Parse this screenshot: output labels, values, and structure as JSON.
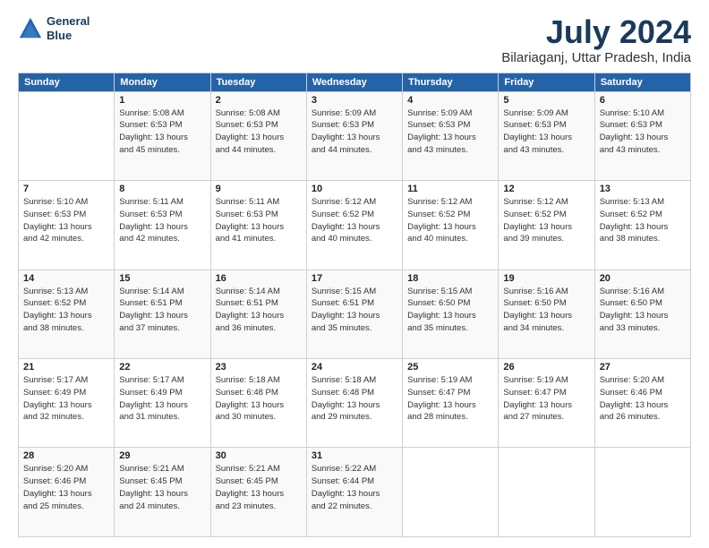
{
  "logo": {
    "line1": "General",
    "line2": "Blue"
  },
  "title": "July 2024",
  "subtitle": "Bilariaganj, Uttar Pradesh, India",
  "header_days": [
    "Sunday",
    "Monday",
    "Tuesday",
    "Wednesday",
    "Thursday",
    "Friday",
    "Saturday"
  ],
  "weeks": [
    [
      {
        "day": "",
        "info": ""
      },
      {
        "day": "1",
        "info": "Sunrise: 5:08 AM\nSunset: 6:53 PM\nDaylight: 13 hours\nand 45 minutes."
      },
      {
        "day": "2",
        "info": "Sunrise: 5:08 AM\nSunset: 6:53 PM\nDaylight: 13 hours\nand 44 minutes."
      },
      {
        "day": "3",
        "info": "Sunrise: 5:09 AM\nSunset: 6:53 PM\nDaylight: 13 hours\nand 44 minutes."
      },
      {
        "day": "4",
        "info": "Sunrise: 5:09 AM\nSunset: 6:53 PM\nDaylight: 13 hours\nand 43 minutes."
      },
      {
        "day": "5",
        "info": "Sunrise: 5:09 AM\nSunset: 6:53 PM\nDaylight: 13 hours\nand 43 minutes."
      },
      {
        "day": "6",
        "info": "Sunrise: 5:10 AM\nSunset: 6:53 PM\nDaylight: 13 hours\nand 43 minutes."
      }
    ],
    [
      {
        "day": "7",
        "info": "Sunrise: 5:10 AM\nSunset: 6:53 PM\nDaylight: 13 hours\nand 42 minutes."
      },
      {
        "day": "8",
        "info": "Sunrise: 5:11 AM\nSunset: 6:53 PM\nDaylight: 13 hours\nand 42 minutes."
      },
      {
        "day": "9",
        "info": "Sunrise: 5:11 AM\nSunset: 6:53 PM\nDaylight: 13 hours\nand 41 minutes."
      },
      {
        "day": "10",
        "info": "Sunrise: 5:12 AM\nSunset: 6:52 PM\nDaylight: 13 hours\nand 40 minutes."
      },
      {
        "day": "11",
        "info": "Sunrise: 5:12 AM\nSunset: 6:52 PM\nDaylight: 13 hours\nand 40 minutes."
      },
      {
        "day": "12",
        "info": "Sunrise: 5:12 AM\nSunset: 6:52 PM\nDaylight: 13 hours\nand 39 minutes."
      },
      {
        "day": "13",
        "info": "Sunrise: 5:13 AM\nSunset: 6:52 PM\nDaylight: 13 hours\nand 38 minutes."
      }
    ],
    [
      {
        "day": "14",
        "info": "Sunrise: 5:13 AM\nSunset: 6:52 PM\nDaylight: 13 hours\nand 38 minutes."
      },
      {
        "day": "15",
        "info": "Sunrise: 5:14 AM\nSunset: 6:51 PM\nDaylight: 13 hours\nand 37 minutes."
      },
      {
        "day": "16",
        "info": "Sunrise: 5:14 AM\nSunset: 6:51 PM\nDaylight: 13 hours\nand 36 minutes."
      },
      {
        "day": "17",
        "info": "Sunrise: 5:15 AM\nSunset: 6:51 PM\nDaylight: 13 hours\nand 35 minutes."
      },
      {
        "day": "18",
        "info": "Sunrise: 5:15 AM\nSunset: 6:50 PM\nDaylight: 13 hours\nand 35 minutes."
      },
      {
        "day": "19",
        "info": "Sunrise: 5:16 AM\nSunset: 6:50 PM\nDaylight: 13 hours\nand 34 minutes."
      },
      {
        "day": "20",
        "info": "Sunrise: 5:16 AM\nSunset: 6:50 PM\nDaylight: 13 hours\nand 33 minutes."
      }
    ],
    [
      {
        "day": "21",
        "info": "Sunrise: 5:17 AM\nSunset: 6:49 PM\nDaylight: 13 hours\nand 32 minutes."
      },
      {
        "day": "22",
        "info": "Sunrise: 5:17 AM\nSunset: 6:49 PM\nDaylight: 13 hours\nand 31 minutes."
      },
      {
        "day": "23",
        "info": "Sunrise: 5:18 AM\nSunset: 6:48 PM\nDaylight: 13 hours\nand 30 minutes."
      },
      {
        "day": "24",
        "info": "Sunrise: 5:18 AM\nSunset: 6:48 PM\nDaylight: 13 hours\nand 29 minutes."
      },
      {
        "day": "25",
        "info": "Sunrise: 5:19 AM\nSunset: 6:47 PM\nDaylight: 13 hours\nand 28 minutes."
      },
      {
        "day": "26",
        "info": "Sunrise: 5:19 AM\nSunset: 6:47 PM\nDaylight: 13 hours\nand 27 minutes."
      },
      {
        "day": "27",
        "info": "Sunrise: 5:20 AM\nSunset: 6:46 PM\nDaylight: 13 hours\nand 26 minutes."
      }
    ],
    [
      {
        "day": "28",
        "info": "Sunrise: 5:20 AM\nSunset: 6:46 PM\nDaylight: 13 hours\nand 25 minutes."
      },
      {
        "day": "29",
        "info": "Sunrise: 5:21 AM\nSunset: 6:45 PM\nDaylight: 13 hours\nand 24 minutes."
      },
      {
        "day": "30",
        "info": "Sunrise: 5:21 AM\nSunset: 6:45 PM\nDaylight: 13 hours\nand 23 minutes."
      },
      {
        "day": "31",
        "info": "Sunrise: 5:22 AM\nSunset: 6:44 PM\nDaylight: 13 hours\nand 22 minutes."
      },
      {
        "day": "",
        "info": ""
      },
      {
        "day": "",
        "info": ""
      },
      {
        "day": "",
        "info": ""
      }
    ]
  ]
}
